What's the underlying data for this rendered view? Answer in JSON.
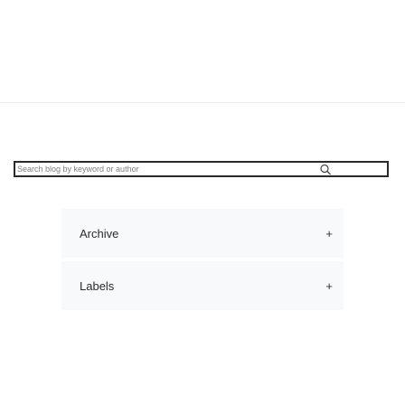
{
  "search": {
    "placeholder": "Search blog by keyword or author",
    "icon": "search-icon"
  },
  "sidebar": {
    "sections": [
      {
        "title": "Archive",
        "toggle": "+"
      },
      {
        "title": "Labels",
        "toggle": "+"
      }
    ]
  }
}
